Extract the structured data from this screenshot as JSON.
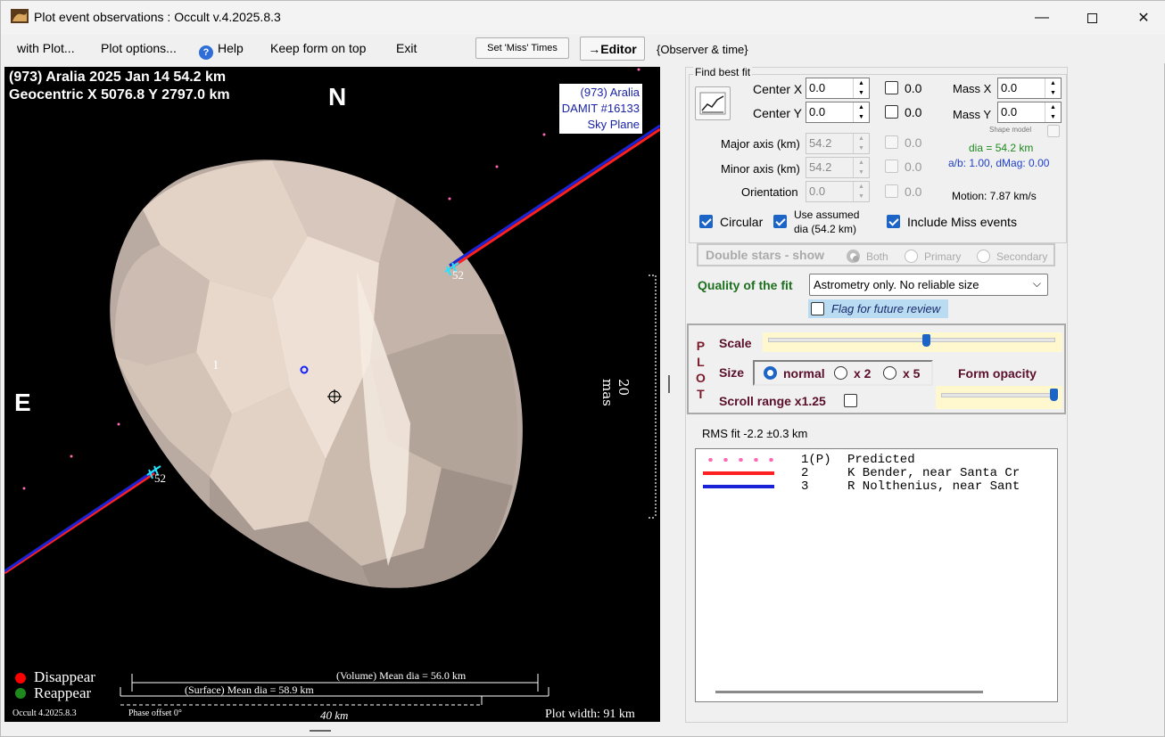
{
  "window": {
    "title": "Plot event observations : Occult v.4.2025.8.3",
    "min": "—",
    "max": "☐",
    "close": "✕"
  },
  "menu": {
    "with_plot": "with Plot...",
    "plot_options": "Plot options...",
    "help": "Help",
    "keep_on_top": "Keep form on top",
    "exit": "Exit",
    "set_miss_times": "Set 'Miss' Times",
    "editor": "→Editor",
    "observer_time": "{Observer & time}"
  },
  "plot": {
    "header_line1": "(973) Aralia  2025 Jan 14   54.2 km",
    "header_line2": "Geocentric  X  5076.8  Y 2797.0 km",
    "info_box": [
      "(973) Aralia",
      "DAMIT #16133",
      "Sky Plane"
    ],
    "north": "N",
    "east": "E",
    "scale_label": "20 mas",
    "chord_label": "1",
    "marker_label_a": "52",
    "marker_label_b": "52",
    "legend": {
      "disappear": "Disappear",
      "reappear": "Reappear",
      "disappear_color": "#ff0000",
      "reappear_color": "#1e8a1e"
    },
    "volume_dia": "(Volume) Mean dia = 56.0 km",
    "surface_dia": "(Surface) Mean dia = 58.9 km",
    "scale_bar": "40 km",
    "footer_version": "Occult 4.2025.8.3",
    "phase_offset": "Phase offset 0°",
    "plot_width": "Plot width: 91 km"
  },
  "fit": {
    "group_title": "Find best fit",
    "center_x": {
      "label": "Center X",
      "value": "0.0",
      "fixed": "0.0"
    },
    "center_y": {
      "label": "Center Y",
      "value": "0.0",
      "fixed": "0.0"
    },
    "major_axis": {
      "label": "Major axis (km)",
      "value": "54.2",
      "fixed": "0.0"
    },
    "minor_axis": {
      "label": "Minor axis (km)",
      "value": "54.2",
      "fixed": "0.0"
    },
    "orientation": {
      "label": "Orientation",
      "value": "0.0",
      "fixed": "0.0"
    },
    "mass_x": {
      "label": "Mass X",
      "value": "0.0"
    },
    "mass_y": {
      "label": "Mass Y",
      "value": "0.0"
    },
    "shape_model": "Shape model",
    "dia": "dia = 54.2 km",
    "ab_dmag": "a/b: 1.00, dMag: 0.00",
    "motion": "Motion: 7.87 km/s",
    "circular": "Circular",
    "use_assumed_1": "Use assumed",
    "use_assumed_2": "dia (54.2 km)",
    "include_miss": "Include Miss events"
  },
  "double_stars": {
    "title": "Double stars - show",
    "both": "Both",
    "primary": "Primary",
    "secondary": "Secondary"
  },
  "quality": {
    "label": "Quality of the fit",
    "value": "Astrometry only. No reliable size",
    "flag": "Flag for future review"
  },
  "plotbox": {
    "vertical": [
      "P",
      "L",
      "O",
      "T"
    ],
    "scale": "Scale",
    "scale_level": 0.55,
    "size": "Size",
    "normal": "normal",
    "x2": "x 2",
    "x5": "x 5",
    "form_opacity": "Form opacity",
    "opacity_level": 1.0,
    "scroll_range": "Scroll range x1.25"
  },
  "rms": "RMS fit -2.2 ±0.3 km",
  "observers": [
    {
      "num": "1(P)",
      "name": "Predicted",
      "style": "dots",
      "color": "#ff69b4"
    },
    {
      "num": "2",
      "name": "K Bender, near Santa Cr",
      "style": "line",
      "color": "#ff2020"
    },
    {
      "num": "3",
      "name": "R Nolthenius, near Sant",
      "style": "line",
      "color": "#1a23d6"
    }
  ]
}
